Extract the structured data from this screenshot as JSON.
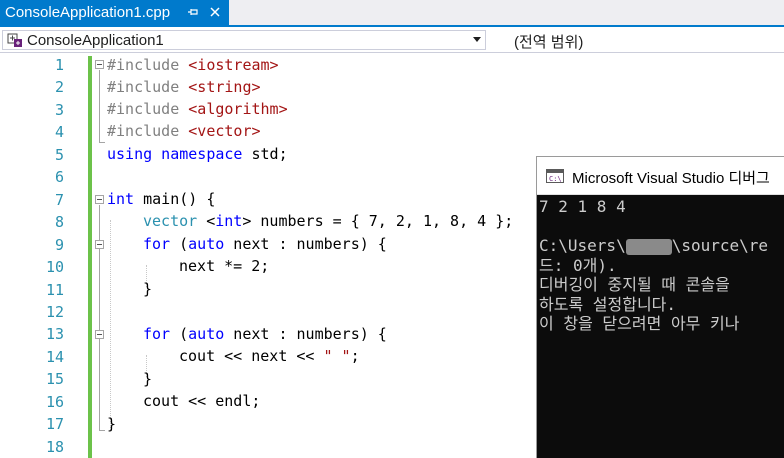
{
  "tab": {
    "title": "ConsoleApplication1.cpp"
  },
  "nav": {
    "scope": "ConsoleApplication1",
    "member": "(전역 범위)"
  },
  "editor": {
    "line_numbers": [
      "1",
      "2",
      "3",
      "4",
      "5",
      "6",
      "7",
      "8",
      "9",
      "10",
      "11",
      "12",
      "13",
      "14",
      "15",
      "16",
      "17",
      "18"
    ],
    "code": {
      "l1_pp": "#include ",
      "l1_inc": "<iostream>",
      "l2_pp": "#include ",
      "l2_inc": "<string>",
      "l3_pp": "#include ",
      "l3_inc": "<algorithm>",
      "l4_pp": "#include ",
      "l4_inc": "<vector>",
      "l5_kw1": "using",
      "l5_kw2": " namespace",
      "l5_rest": " std;",
      "l7_kw": "int",
      "l7_rest": " main() {",
      "l8_ty": "vector",
      "l8_lt": " <",
      "l8_kw": "int",
      "l8_rest": "> numbers = { 7, 2, 1, 8, 4 };",
      "l9_kw": "for",
      "l9_p1": " (",
      "l9_kw2": "auto",
      "l9_rest": " next : numbers) {",
      "l10": "next *= 2;",
      "l11": "}",
      "l13_kw": "for",
      "l13_p1": " (",
      "l13_kw2": "auto",
      "l13_rest": " next : numbers) {",
      "l14_a": "cout << next << ",
      "l14_str": "\" \"",
      "l14_b": ";",
      "l15": "}",
      "l16": "cout << endl;",
      "l17": "}"
    }
  },
  "console": {
    "title": "Microsoft Visual Studio 디버그",
    "output_line": "7 2 1 8 4",
    "path_a": "C:\\Users\\",
    "path_b": "\\source\\re",
    "line3": "드: 0개).",
    "line4": "디버깅이 중지될 때 콘솔을",
    "line5": "하도록 설정합니다.",
    "line6": "이 창을 닫으려면 아무 키나"
  }
}
